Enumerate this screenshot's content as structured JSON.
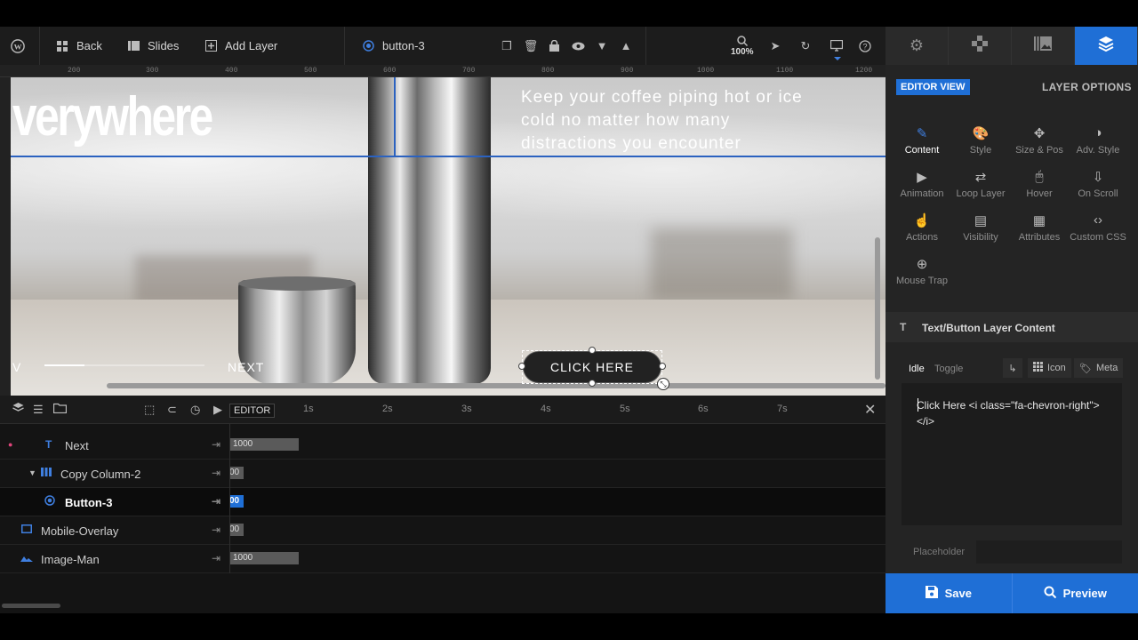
{
  "toolbar": {
    "back_label": "Back",
    "slides_label": "Slides",
    "add_layer_label": "Add Layer",
    "selected_layer": "button-3",
    "zoom": "100%"
  },
  "ruler": {
    "ticks": [
      "200",
      "300",
      "400",
      "500",
      "600",
      "700",
      "800",
      "900",
      "1000",
      "1100",
      "1200"
    ]
  },
  "canvas": {
    "headline": "verywhere",
    "subcopy": "Keep your coffee piping hot or ice cold no matter how many distractions you encounter",
    "prev_label": "V",
    "next_label": "NEXT",
    "cta_label": "CLICK HERE",
    "slider_progress_fraction": 0.25
  },
  "timeline": {
    "editor_label": "EDITOR",
    "seconds": [
      "1s",
      "2s",
      "3s",
      "4s",
      "5s",
      "6s",
      "7s"
    ],
    "layers": [
      {
        "name": "Next",
        "value": "1000"
      },
      {
        "name": "Copy Column-2",
        "value": "00"
      },
      {
        "name": "Button-3",
        "value": "00",
        "selected": true
      },
      {
        "name": "Mobile-Overlay",
        "value": "00"
      },
      {
        "name": "Image-Man",
        "value": "1000"
      }
    ]
  },
  "panel": {
    "editor_view": "EDITOR VIEW",
    "layer_options": "LAYER OPTIONS",
    "options": [
      "Content",
      "Style",
      "Size & Pos",
      "Adv. Style",
      "Animation",
      "Loop Layer",
      "Hover",
      "On Scroll",
      "Actions",
      "Visibility",
      "Attributes",
      "Custom CSS",
      "Mouse Trap"
    ],
    "section_title": "Text/Button Layer Content",
    "subtabs": {
      "idle": "Idle",
      "toggle": "Toggle"
    },
    "icon_btn": "Icon",
    "meta_btn": "Meta",
    "content_code": "Click Here <i class=\"fa-chevron-right\"></i>",
    "placeholder_label": "Placeholder"
  },
  "actions": {
    "save_label": "Save",
    "preview_label": "Preview"
  },
  "colors": {
    "accent": "#1f6fd6",
    "toolbar_bg": "#1c1c1c",
    "panel_bg": "#242424"
  }
}
